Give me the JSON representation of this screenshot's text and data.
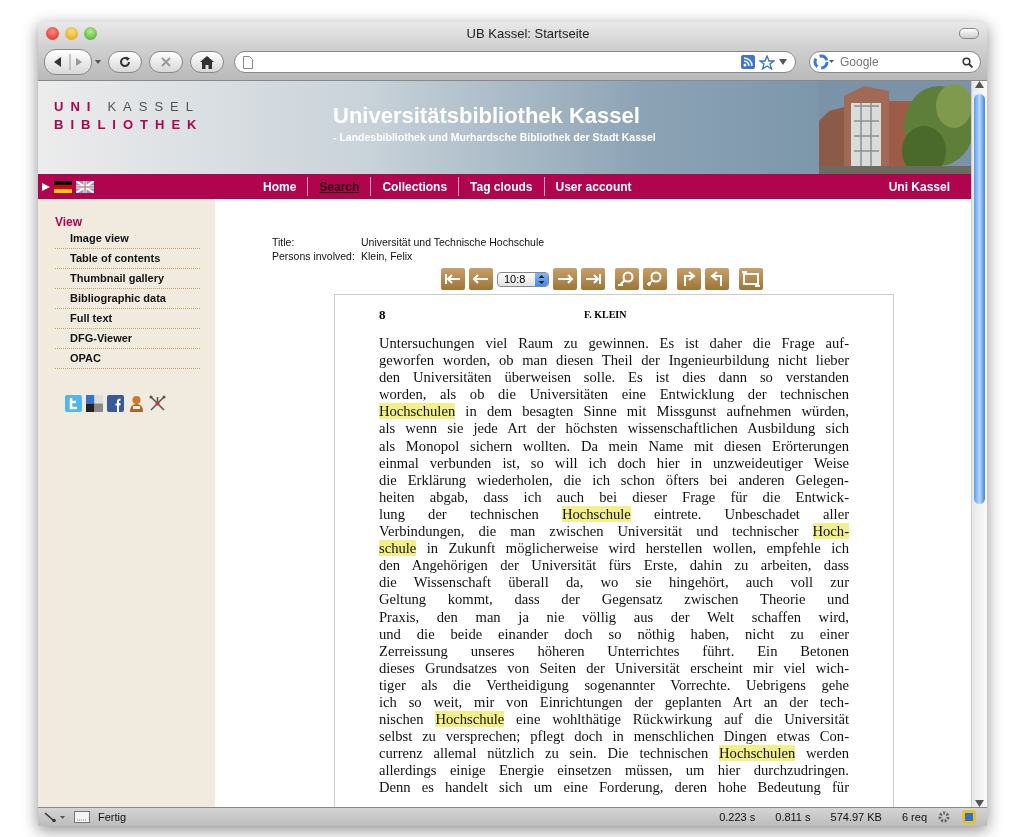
{
  "window": {
    "title": "UB Kassel: Startseite"
  },
  "toolbar": {
    "search": {
      "placeholder": "Google"
    }
  },
  "header": {
    "logo": {
      "uni": "UNI",
      "kassel": "KASSEL",
      "bibliothek": "BIBLIOTHEK"
    },
    "title": "Universitätsbibliothek Kassel",
    "subtitle": "- Landesbibliothek und Murhardsche Bibliothek der Stadt Kassel"
  },
  "nav": {
    "items": [
      {
        "label": "Home",
        "selected": false
      },
      {
        "label": "Search",
        "selected": true
      },
      {
        "label": "Collections",
        "selected": false
      },
      {
        "label": "Tag clouds",
        "selected": false
      },
      {
        "label": "User account",
        "selected": false
      }
    ],
    "right_link": "Uni Kassel"
  },
  "sidebar": {
    "heading": "View",
    "items": [
      "Image view",
      "Table of contents",
      "Thumbnail gallery",
      "Bibliographic data",
      "Full text",
      "DFG-Viewer",
      "OPAC"
    ]
  },
  "metadata": [
    {
      "label": "Title:",
      "value": "Universität und Technische Hochschule"
    },
    {
      "label": "Persons involved:",
      "value": "Klein, Felix"
    }
  ],
  "viewer": {
    "page_select": "10:8"
  },
  "page": {
    "number": "8",
    "running_head": "F. KLEIN",
    "lines": [
      [
        {
          "text": "Untersuchungen viel Raum zu gewinnen.  Es ist daher die Frage auf-",
          "highlighted": false
        }
      ],
      [
        {
          "text": "geworfen worden, ob man diesen Theil der Ingenieurbildung nicht lieber",
          "highlighted": false
        }
      ],
      [
        {
          "text": "den Universitäten überweisen solle.  Es ist dies dann so verstanden",
          "highlighted": false
        }
      ],
      [
        {
          "text": "worden, als ob die Universitäten eine Entwicklung der technischen",
          "highlighted": false
        }
      ],
      [
        {
          "text": "Hochschulen",
          "highlighted": true
        },
        {
          "text": " in dem besagten Sinne mit Missgunst aufnehmen würden,",
          "highlighted": false
        }
      ],
      [
        {
          "text": "als wenn sie jede Art der höchsten wissenschaftlichen Ausbildung sich",
          "highlighted": false
        }
      ],
      [
        {
          "text": "als Monopol sichern wollten.  Da mein Name mit diesen Erörterungen",
          "highlighted": false
        }
      ],
      [
        {
          "text": "einmal verbunden ist, so will ich doch hier in unzweideutiger Weise",
          "highlighted": false
        }
      ],
      [
        {
          "text": "die Erklärung wiederholen, die ich schon öfters bei anderen Gelegen-",
          "highlighted": false
        }
      ],
      [
        {
          "text": "heiten abgab, dass ich auch bei dieser Frage für die Entwick-",
          "highlighted": false
        }
      ],
      [
        {
          "text": "lung der technischen ",
          "highlighted": false
        },
        {
          "text": "Hochschule",
          "highlighted": true
        },
        {
          "text": " eintrete.  Unbeschadet aller",
          "highlighted": false
        }
      ],
      [
        {
          "text": "Verbindungen, die man zwischen Universität und technischer ",
          "highlighted": false
        },
        {
          "text": "Hoch-",
          "highlighted": true
        }
      ],
      [
        {
          "text": "schule",
          "highlighted": true
        },
        {
          "text": " in Zukunft möglicherweise wird herstellen wollen, empfehle ich",
          "highlighted": false
        }
      ],
      [
        {
          "text": "den Angehörigen der Universität fürs Erste, dahin zu arbeiten, dass",
          "highlighted": false
        }
      ],
      [
        {
          "text": "die Wissenschaft überall da, wo sie hingehört, auch voll zur",
          "highlighted": false
        }
      ],
      [
        {
          "text": "Geltung kommt, dass der Gegensatz zwischen Theorie und",
          "highlighted": false
        }
      ],
      [
        {
          "text": "Praxis, den man ja nie völlig aus der Welt schaffen wird,",
          "highlighted": false
        }
      ],
      [
        {
          "text": "und die beide einander doch so nöthig haben, nicht zu einer",
          "highlighted": false
        }
      ],
      [
        {
          "text": "Zerreissung unseres höheren Unterrichtes führt.  Ein Betonen",
          "highlighted": false
        }
      ],
      [
        {
          "text": "dieses Grundsatzes von Seiten der Universität erscheint mir viel wich-",
          "highlighted": false
        }
      ],
      [
        {
          "text": "tiger als die Vertheidigung sogenannter Vorrechte.  Uebrigens gehe",
          "highlighted": false
        }
      ],
      [
        {
          "text": "ich so weit, mir von Einrichtungen der geplanten Art an der tech-",
          "highlighted": false
        }
      ],
      [
        {
          "text": "nischen ",
          "highlighted": false
        },
        {
          "text": "Hochschule",
          "highlighted": true
        },
        {
          "text": " eine wohlthätige Rückwirkung auf die Universität",
          "highlighted": false
        }
      ],
      [
        {
          "text": "selbst zu versprechen; pflegt doch in menschlichen Dingen etwas Con-",
          "highlighted": false
        }
      ],
      [
        {
          "text": "currenz allemal nützlich zu sein.  Die technischen ",
          "highlighted": false
        },
        {
          "text": "Hochschulen",
          "highlighted": true
        },
        {
          "text": " werden",
          "highlighted": false
        }
      ],
      [
        {
          "text": "allerdings einige Energie einsetzen müssen, um hier durchzudringen.",
          "highlighted": false
        }
      ],
      [
        {
          "text": "Denn es handelt sich um eine Forderung, deren hohe Bedeutung für",
          "highlighted": false
        }
      ]
    ]
  },
  "status_bar": {
    "text": "Fertig",
    "metrics": [
      "0.223 s",
      "0.811 s",
      "574.97 KB",
      "6 req"
    ]
  }
}
